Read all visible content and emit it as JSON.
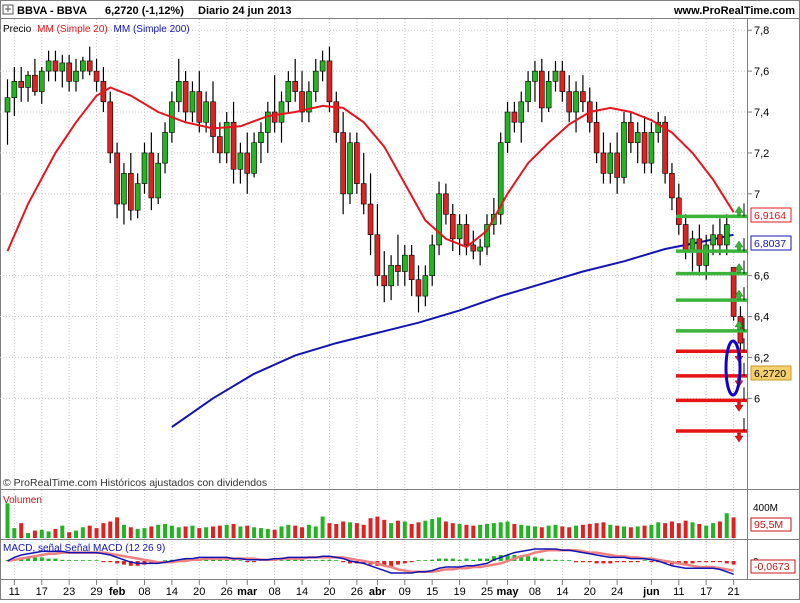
{
  "header": {
    "instrument": "BBVA - BBVA",
    "price_change": "6,2720 (-1,12%)",
    "timeframe_date": "Diario  24 jun 2013",
    "site": "www.ProRealTime.com"
  },
  "price_panel": {
    "label_price": "Precio",
    "label_mm20": "MM (Simple 20)",
    "label_mm200": "MM (Simple 200)",
    "footer_note": "© ProRealTime.com Históricos ajustados con dividendos",
    "tag_mm20": "6,9164",
    "tag_mm200": "6,8037",
    "tag_last": "6,2720"
  },
  "volume_panel": {
    "label": "Volumen",
    "axis_label": "400M",
    "tag_last": "95,5M"
  },
  "macd_panel": {
    "label": "MACD, señal Señal MACD (12 26 9)",
    "tag_last": "-0,0673",
    "zero_label": "0"
  },
  "colors": {
    "up": "#22b422",
    "down": "#dd2222",
    "mm20": "#e8141e",
    "mm200": "#1414b4",
    "support": "#3cb43c",
    "resistance": "#e61414",
    "grid": "#c8c8c8",
    "highlight": "#1400c8"
  },
  "chart_data": {
    "type": "candlestick",
    "yaxis_side": "right",
    "ylim": [
      5.75,
      7.85
    ],
    "y_ticks": [
      6,
      6.2,
      6.4,
      6.6,
      7,
      7.2,
      7.4,
      7.6,
      7.8
    ],
    "y_tick_labels": [
      "6",
      "6,2",
      "6,4",
      "6,6",
      "7",
      "7,2",
      "7,4",
      "7,6",
      "7,8"
    ],
    "x_ticks": [
      {
        "i": 1,
        "label": "11"
      },
      {
        "i": 5,
        "label": "17"
      },
      {
        "i": 9,
        "label": "23"
      },
      {
        "i": 13,
        "label": "29"
      },
      {
        "i": 16,
        "label": "feb"
      },
      {
        "i": 20,
        "label": "08"
      },
      {
        "i": 24,
        "label": "14"
      },
      {
        "i": 28,
        "label": "20"
      },
      {
        "i": 32,
        "label": "26"
      },
      {
        "i": 35,
        "label": "mar"
      },
      {
        "i": 39,
        "label": "08"
      },
      {
        "i": 43,
        "label": "14"
      },
      {
        "i": 47,
        "label": "20"
      },
      {
        "i": 51,
        "label": "26"
      },
      {
        "i": 54,
        "label": "abr"
      },
      {
        "i": 58,
        "label": "09"
      },
      {
        "i": 62,
        "label": "15"
      },
      {
        "i": 66,
        "label": "19"
      },
      {
        "i": 70,
        "label": "25"
      },
      {
        "i": 73,
        "label": "may"
      },
      {
        "i": 77,
        "label": "08"
      },
      {
        "i": 81,
        "label": "14"
      },
      {
        "i": 85,
        "label": "20"
      },
      {
        "i": 89,
        "label": "24"
      },
      {
        "i": 94,
        "label": "jun"
      },
      {
        "i": 98,
        "label": "11"
      },
      {
        "i": 102,
        "label": "17"
      },
      {
        "i": 106,
        "label": "21"
      }
    ],
    "bars": [
      [
        7.4,
        7.56,
        7.24,
        7.47
      ],
      [
        7.47,
        7.62,
        7.38,
        7.55
      ],
      [
        7.55,
        7.62,
        7.45,
        7.52
      ],
      [
        7.52,
        7.6,
        7.45,
        7.58
      ],
      [
        7.58,
        7.66,
        7.48,
        7.5
      ],
      [
        7.5,
        7.62,
        7.44,
        7.6
      ],
      [
        7.6,
        7.7,
        7.55,
        7.65
      ],
      [
        7.65,
        7.7,
        7.55,
        7.6
      ],
      [
        7.6,
        7.68,
        7.52,
        7.64
      ],
      [
        7.64,
        7.68,
        7.5,
        7.55
      ],
      [
        7.55,
        7.66,
        7.5,
        7.6
      ],
      [
        7.6,
        7.67,
        7.56,
        7.65
      ],
      [
        7.65,
        7.72,
        7.58,
        7.6
      ],
      [
        7.6,
        7.66,
        7.5,
        7.55
      ],
      [
        7.55,
        7.62,
        7.4,
        7.45
      ],
      [
        7.45,
        7.5,
        7.15,
        7.2
      ],
      [
        7.2,
        7.25,
        6.88,
        6.95
      ],
      [
        6.95,
        7.15,
        6.85,
        7.1
      ],
      [
        7.1,
        7.2,
        6.87,
        6.92
      ],
      [
        6.92,
        7.1,
        6.88,
        7.05
      ],
      [
        7.05,
        7.25,
        7.0,
        7.2
      ],
      [
        7.2,
        7.3,
        6.92,
        6.98
      ],
      [
        6.98,
        7.2,
        6.95,
        7.15
      ],
      [
        7.15,
        7.35,
        7.1,
        7.3
      ],
      [
        7.3,
        7.5,
        7.25,
        7.45
      ],
      [
        7.45,
        7.66,
        7.4,
        7.55
      ],
      [
        7.55,
        7.6,
        7.35,
        7.4
      ],
      [
        7.4,
        7.55,
        7.35,
        7.5
      ],
      [
        7.5,
        7.6,
        7.3,
        7.35
      ],
      [
        7.35,
        7.5,
        7.3,
        7.45
      ],
      [
        7.45,
        7.55,
        7.2,
        7.28
      ],
      [
        7.28,
        7.35,
        7.15,
        7.2
      ],
      [
        7.2,
        7.4,
        7.15,
        7.35
      ],
      [
        7.35,
        7.45,
        7.05,
        7.12
      ],
      [
        7.12,
        7.25,
        7.05,
        7.2
      ],
      [
        7.2,
        7.3,
        7.0,
        7.1
      ],
      [
        7.1,
        7.3,
        7.08,
        7.25
      ],
      [
        7.25,
        7.35,
        7.15,
        7.3
      ],
      [
        7.3,
        7.45,
        7.2,
        7.4
      ],
      [
        7.4,
        7.58,
        7.3,
        7.35
      ],
      [
        7.35,
        7.5,
        7.25,
        7.45
      ],
      [
        7.45,
        7.6,
        7.4,
        7.55
      ],
      [
        7.55,
        7.66,
        7.45,
        7.5
      ],
      [
        7.5,
        7.6,
        7.35,
        7.4
      ],
      [
        7.4,
        7.55,
        7.35,
        7.5
      ],
      [
        7.5,
        7.66,
        7.45,
        7.6
      ],
      [
        7.6,
        7.7,
        7.55,
        7.65
      ],
      [
        7.65,
        7.72,
        7.4,
        7.45
      ],
      [
        7.45,
        7.5,
        7.25,
        7.3
      ],
      [
        7.3,
        7.4,
        6.9,
        7.0
      ],
      [
        7.0,
        7.3,
        6.95,
        7.25
      ],
      [
        7.25,
        7.3,
        7.0,
        7.05
      ],
      [
        7.05,
        7.2,
        6.9,
        6.95
      ],
      [
        6.95,
        7.1,
        6.7,
        6.8
      ],
      [
        6.8,
        6.95,
        6.55,
        6.6
      ],
      [
        6.6,
        6.72,
        6.47,
        6.55
      ],
      [
        6.55,
        6.7,
        6.48,
        6.65
      ],
      [
        6.65,
        6.8,
        6.55,
        6.62
      ],
      [
        6.62,
        6.75,
        6.55,
        6.7
      ],
      [
        6.7,
        6.75,
        6.5,
        6.58
      ],
      [
        6.58,
        6.65,
        6.42,
        6.5
      ],
      [
        6.5,
        6.65,
        6.45,
        6.6
      ],
      [
        6.6,
        6.8,
        6.55,
        6.75
      ],
      [
        6.75,
        7.06,
        6.7,
        7.0
      ],
      [
        7.0,
        7.05,
        6.85,
        6.9
      ],
      [
        6.9,
        6.95,
        6.72,
        6.78
      ],
      [
        6.78,
        6.9,
        6.7,
        6.85
      ],
      [
        6.85,
        6.9,
        6.7,
        6.75
      ],
      [
        6.75,
        6.82,
        6.68,
        6.72
      ],
      [
        6.72,
        6.78,
        6.65,
        6.74
      ],
      [
        6.74,
        6.9,
        6.7,
        6.85
      ],
      [
        6.85,
        6.98,
        6.8,
        6.9
      ],
      [
        6.9,
        7.3,
        6.85,
        7.25
      ],
      [
        7.25,
        7.45,
        7.2,
        7.4
      ],
      [
        7.4,
        7.45,
        7.3,
        7.35
      ],
      [
        7.35,
        7.5,
        7.25,
        7.45
      ],
      [
        7.45,
        7.6,
        7.4,
        7.55
      ],
      [
        7.55,
        7.65,
        7.45,
        7.6
      ],
      [
        7.6,
        7.66,
        7.35,
        7.42
      ],
      [
        7.42,
        7.6,
        7.4,
        7.55
      ],
      [
        7.55,
        7.65,
        7.5,
        7.6
      ],
      [
        7.6,
        7.65,
        7.45,
        7.5
      ],
      [
        7.5,
        7.58,
        7.35,
        7.4
      ],
      [
        7.4,
        7.55,
        7.3,
        7.5
      ],
      [
        7.5,
        7.58,
        7.4,
        7.45
      ],
      [
        7.45,
        7.52,
        7.3,
        7.35
      ],
      [
        7.35,
        7.45,
        7.15,
        7.2
      ],
      [
        7.2,
        7.3,
        7.05,
        7.1
      ],
      [
        7.1,
        7.25,
        7.05,
        7.2
      ],
      [
        7.2,
        7.3,
        7.0,
        7.08
      ],
      [
        7.08,
        7.4,
        7.05,
        7.35
      ],
      [
        7.35,
        7.4,
        7.2,
        7.25
      ],
      [
        7.25,
        7.35,
        7.15,
        7.3
      ],
      [
        7.3,
        7.38,
        7.1,
        7.15
      ],
      [
        7.15,
        7.35,
        7.1,
        7.3
      ],
      [
        7.3,
        7.4,
        7.25,
        7.35
      ],
      [
        7.35,
        7.38,
        7.05,
        7.1
      ],
      [
        7.1,
        7.15,
        6.92,
        6.98
      ],
      [
        6.98,
        7.05,
        6.8,
        6.85
      ],
      [
        6.85,
        6.9,
        6.68,
        6.72
      ],
      [
        6.72,
        6.82,
        6.62,
        6.78
      ],
      [
        6.78,
        6.85,
        6.6,
        6.65
      ],
      [
        6.65,
        6.8,
        6.58,
        6.75
      ],
      [
        6.75,
        6.85,
        6.7,
        6.8
      ],
      [
        6.8,
        6.88,
        6.7,
        6.75
      ],
      [
        6.75,
        6.9,
        6.7,
        6.85
      ],
      [
        6.64,
        6.64,
        6.38,
        6.4
      ],
      [
        6.4,
        6.45,
        6.2,
        6.27
      ]
    ],
    "mm20": [
      [
        0,
        6.72
      ],
      [
        3,
        6.95
      ],
      [
        7,
        7.2
      ],
      [
        10,
        7.35
      ],
      [
        13,
        7.48
      ],
      [
        15,
        7.52
      ],
      [
        18,
        7.48
      ],
      [
        22,
        7.4
      ],
      [
        26,
        7.35
      ],
      [
        30,
        7.32
      ],
      [
        34,
        7.33
      ],
      [
        38,
        7.38
      ],
      [
        42,
        7.4
      ],
      [
        46,
        7.43
      ],
      [
        49,
        7.42
      ],
      [
        52,
        7.35
      ],
      [
        55,
        7.23
      ],
      [
        58,
        7.05
      ],
      [
        61,
        6.87
      ],
      [
        64,
        6.78
      ],
      [
        67,
        6.74
      ],
      [
        70,
        6.82
      ],
      [
        73,
        7.0
      ],
      [
        76,
        7.15
      ],
      [
        79,
        7.25
      ],
      [
        82,
        7.34
      ],
      [
        85,
        7.4
      ],
      [
        88,
        7.42
      ],
      [
        91,
        7.4
      ],
      [
        94,
        7.36
      ],
      [
        97,
        7.3
      ],
      [
        100,
        7.2
      ],
      [
        103,
        7.07
      ],
      [
        106,
        6.91
      ]
    ],
    "mm200": [
      [
        24,
        5.86
      ],
      [
        30,
        6.0
      ],
      [
        36,
        6.12
      ],
      [
        42,
        6.21
      ],
      [
        48,
        6.27
      ],
      [
        54,
        6.32
      ],
      [
        60,
        6.37
      ],
      [
        66,
        6.43
      ],
      [
        72,
        6.5
      ],
      [
        78,
        6.56
      ],
      [
        84,
        6.62
      ],
      [
        90,
        6.67
      ],
      [
        96,
        6.73
      ],
      [
        102,
        6.77
      ],
      [
        106,
        6.8
      ]
    ],
    "levels": [
      {
        "value": 6.89,
        "kind": "support"
      },
      {
        "value": 6.72,
        "kind": "support"
      },
      {
        "value": 6.61,
        "kind": "support"
      },
      {
        "value": 6.48,
        "kind": "support"
      },
      {
        "value": 6.33,
        "kind": "support"
      },
      {
        "value": 6.23,
        "kind": "resistance"
      },
      {
        "value": 6.11,
        "kind": "resistance"
      },
      {
        "value": 5.99,
        "kind": "resistance"
      },
      {
        "value": 5.84,
        "kind": "resistance"
      }
    ],
    "volume_max": 400,
    "volume": [
      420,
      120,
      180,
      60,
      90,
      100,
      80,
      110,
      150,
      70,
      90,
      130,
      150,
      120,
      180,
      200,
      250,
      160,
      130,
      110,
      120,
      140,
      160,
      170,
      150,
      130,
      140,
      150,
      120,
      130,
      140,
      150,
      160,
      170,
      140,
      150,
      130,
      120,
      110,
      100,
      140,
      160,
      150,
      130,
      160,
      140,
      260,
      180,
      170,
      200,
      190,
      180,
      160,
      240,
      260,
      220,
      180,
      210,
      200,
      170,
      190,
      210,
      230,
      250,
      200,
      180,
      170,
      160,
      150,
      160,
      170,
      180,
      190,
      200,
      170,
      160,
      150,
      140,
      130,
      150,
      160,
      140,
      130,
      150,
      160,
      170,
      180,
      190,
      160,
      150,
      140,
      130,
      140,
      150,
      160,
      190,
      180,
      200,
      180,
      210,
      190,
      170,
      150,
      180,
      200,
      300,
      250
    ],
    "macd": [
      0.0,
      0.3,
      0.5,
      0.6,
      0.7,
      0.8,
      0.8,
      0.8,
      0.8,
      0.7,
      0.7,
      0.7,
      0.7,
      0.7,
      0.6,
      0.5,
      0.3,
      0.1,
      -0.1,
      -0.2,
      -0.2,
      -0.2,
      -0.2,
      -0.1,
      0.0,
      0.1,
      0.2,
      0.2,
      0.3,
      0.3,
      0.3,
      0.3,
      0.3,
      0.2,
      0.2,
      0.1,
      0.1,
      0.1,
      0.1,
      0.2,
      0.2,
      0.3,
      0.3,
      0.3,
      0.3,
      0.3,
      0.4,
      0.4,
      0.3,
      0.2,
      0.0,
      -0.1,
      -0.2,
      -0.4,
      -0.6,
      -0.8,
      -1.0,
      -1.0,
      -1.0,
      -1.0,
      -0.9,
      -0.9,
      -0.8,
      -0.6,
      -0.5,
      -0.5,
      -0.5,
      -0.4,
      -0.4,
      -0.3,
      -0.2,
      0.1,
      0.3,
      0.5,
      0.7,
      0.8,
      0.9,
      1.0,
      1.0,
      1.0,
      1.0,
      0.9,
      0.9,
      0.8,
      0.7,
      0.6,
      0.5,
      0.4,
      0.3,
      0.3,
      0.3,
      0.2,
      0.2,
      0.2,
      0.1,
      0.0,
      -0.2,
      -0.4,
      -0.5,
      -0.6,
      -0.6,
      -0.6,
      -0.6,
      -0.6,
      -0.7,
      -0.9,
      -1.1
    ],
    "signal": [
      0.0,
      0.1,
      0.2,
      0.3,
      0.4,
      0.5,
      0.6,
      0.6,
      0.7,
      0.7,
      0.7,
      0.7,
      0.7,
      0.7,
      0.7,
      0.6,
      0.5,
      0.4,
      0.3,
      0.2,
      0.1,
      0.0,
      -0.1,
      -0.1,
      -0.1,
      0.0,
      0.0,
      0.1,
      0.1,
      0.2,
      0.2,
      0.2,
      0.2,
      0.2,
      0.2,
      0.2,
      0.2,
      0.1,
      0.1,
      0.1,
      0.2,
      0.2,
      0.2,
      0.2,
      0.3,
      0.3,
      0.3,
      0.3,
      0.3,
      0.3,
      0.2,
      0.1,
      0.0,
      -0.1,
      -0.2,
      -0.4,
      -0.5,
      -0.7,
      -0.8,
      -0.9,
      -0.9,
      -0.9,
      -0.9,
      -0.8,
      -0.7,
      -0.7,
      -0.6,
      -0.6,
      -0.5,
      -0.5,
      -0.4,
      -0.3,
      -0.2,
      0.0,
      0.2,
      0.4,
      0.5,
      0.7,
      0.8,
      0.9,
      0.9,
      0.9,
      0.9,
      0.9,
      0.8,
      0.7,
      0.7,
      0.6,
      0.5,
      0.4,
      0.4,
      0.3,
      0.3,
      0.2,
      0.2,
      0.1,
      0.0,
      -0.1,
      -0.2,
      -0.3,
      -0.4,
      -0.5,
      -0.5,
      -0.5,
      -0.6,
      -0.7,
      -0.8
    ]
  }
}
